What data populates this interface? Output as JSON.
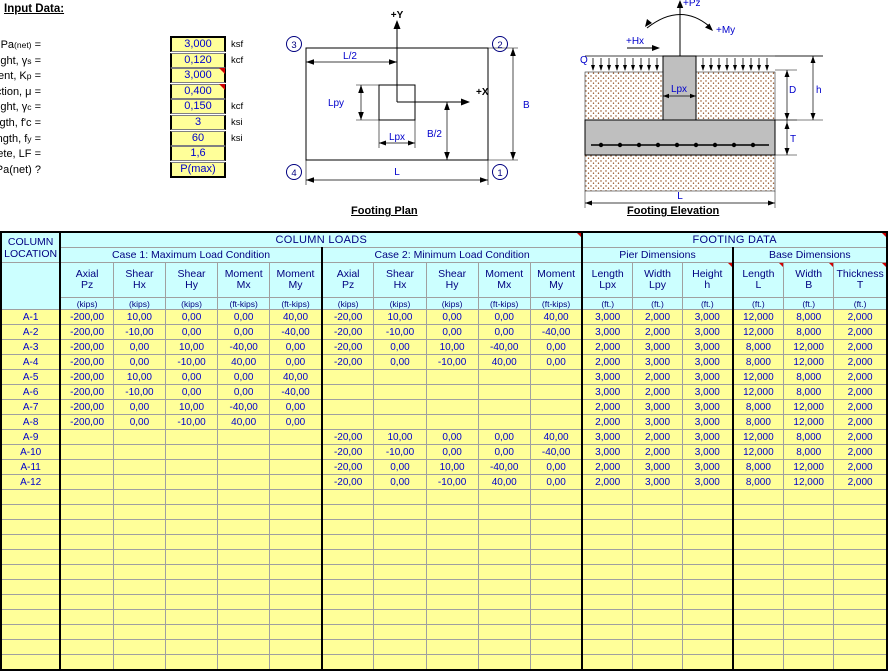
{
  "input_panel": {
    "title": "Input Data:",
    "rows": [
      {
        "label": "Allow. Net Soil Pressure, Pa(net) =",
        "label_main": "Allow. Net Soil Pressure, Pa",
        "label_sub": "(net)",
        "label_tail": " =",
        "value": "3,000",
        "unit": "ksf",
        "comment": false
      },
      {
        "label": "Soil Unit Weight, γs =",
        "label_main": "Soil Unit Weight, γ",
        "label_sub": "s",
        "label_tail": " =",
        "value": "0,120",
        "unit": "kcf",
        "comment": false
      },
      {
        "label": "Passive Pressure Coefficient, Kp =",
        "label_main": "Passive Pressure Coefficient, K",
        "label_sub": "p",
        "label_tail": " =",
        "value": "3,000",
        "unit": "",
        "comment": true
      },
      {
        "label": "Coefficient of Base Friction, μ =",
        "label_main": "Coefficient of Base Friction, μ",
        "label_sub": "",
        "label_tail": " =",
        "value": "0,400",
        "unit": "",
        "comment": true
      },
      {
        "label": "Concrete Unit Weight, γc =",
        "label_main": "Concrete Unit Weight, γ",
        "label_sub": "c",
        "label_tail": " =",
        "value": "0,150",
        "unit": "kcf",
        "comment": false
      },
      {
        "label": "Conc. Compressive Strength, f'c =",
        "label_main": "Conc. Compressive Strength, f'c",
        "label_sub": "",
        "label_tail": " =",
        "value": "3",
        "unit": "ksi",
        "comment": false
      },
      {
        "label": "Reinforcing Yield Strength, fy =",
        "label_main": "Reinforcing Yield Strength, f",
        "label_sub": "y",
        "label_tail": " =",
        "value": "60",
        "unit": "ksi",
        "comment": false
      },
      {
        "label": "USD Load Fact. for Concrete, LF =",
        "label_main": "USD Load Fact. for Concrete, LF",
        "label_sub": "",
        "label_tail": " =",
        "value": "1,6",
        "unit": "",
        "comment": false
      },
      {
        "label": "Design for P(max)net or Pa(net) ?",
        "label_main": "Design for P",
        "label_sub": "(max)net",
        "label_tail": " or Pa(net) ?",
        "value": "P(max)",
        "unit": "",
        "comment": false
      }
    ]
  },
  "plan_diagram": {
    "caption": "Footing Plan",
    "labels": {
      "axis_y": "+Y",
      "axis_x": "+X",
      "corner_1": "1",
      "corner_2": "2",
      "corner_3": "3",
      "corner_4": "4",
      "dim_L": "L",
      "dim_L_half": "L/2",
      "dim_B": "B",
      "dim_B_half": "B/2",
      "dim_Lpx": "Lpx",
      "dim_Lpy": "Lpy"
    }
  },
  "elevation_diagram": {
    "caption": "Footing Elevation",
    "labels": {
      "axial": "+Pz",
      "moment": "+My",
      "shear": "+Hx",
      "surcharge": "Q",
      "pier_width": "Lpx",
      "depth_D": "D",
      "height_h": "h",
      "thickness_T": "T",
      "length_L": "L"
    }
  },
  "table": {
    "group_headers": [
      {
        "label": "COLUMN LOADS",
        "span": 10
      },
      {
        "label": "FOOTING DATA",
        "span": 6
      }
    ],
    "case_headers": [
      {
        "label": "Case 1: Maximum Load Condition",
        "span": 5
      },
      {
        "label": "Case 2: Minimum Load Condition",
        "span": 5
      },
      {
        "label": "Pier Dimensions",
        "span": 3
      },
      {
        "label": "Base Dimensions",
        "span": 3
      }
    ],
    "row_header": "COLUMN LOCATION",
    "row_header_line1": "COLUMN",
    "row_header_line2": "LOCATION",
    "columns": [
      {
        "name_line1": "Axial",
        "name_line2": "Pz",
        "unit": "(kips)",
        "comment": false
      },
      {
        "name_line1": "Shear",
        "name_line2": "Hx",
        "unit": "(kips)",
        "comment": false
      },
      {
        "name_line1": "Shear",
        "name_line2": "Hy",
        "unit": "(kips)",
        "comment": false
      },
      {
        "name_line1": "Moment",
        "name_line2": "Mx",
        "unit": "(ft-kips)",
        "comment": false
      },
      {
        "name_line1": "Moment",
        "name_line2": "My",
        "unit": "(ft-kips)",
        "comment": false
      },
      {
        "name_line1": "Axial",
        "name_line2": "Pz",
        "unit": "(kips)",
        "comment": false
      },
      {
        "name_line1": "Shear",
        "name_line2": "Hx",
        "unit": "(kips)",
        "comment": false
      },
      {
        "name_line1": "Shear",
        "name_line2": "Hy",
        "unit": "(kips)",
        "comment": false
      },
      {
        "name_line1": "Moment",
        "name_line2": "Mx",
        "unit": "(ft-kips)",
        "comment": false
      },
      {
        "name_line1": "Moment",
        "name_line2": "My",
        "unit": "(ft-kips)",
        "comment": false
      },
      {
        "name_line1": "Length",
        "name_line2": "Lpx",
        "unit": "(ft.)",
        "comment": false
      },
      {
        "name_line1": "Width",
        "name_line2": "Lpy",
        "unit": "(ft.)",
        "comment": false
      },
      {
        "name_line1": "Height",
        "name_line2": "h",
        "unit": "(ft.)",
        "comment": true
      },
      {
        "name_line1": "Length",
        "name_line2": "L",
        "unit": "(ft.)",
        "comment": true
      },
      {
        "name_line1": "Width",
        "name_line2": "B",
        "unit": "(ft.)",
        "comment": true
      },
      {
        "name_line1": "Thickness",
        "name_line2": "T",
        "unit": "(ft.)",
        "comment": true
      }
    ],
    "rows": [
      {
        "loc": "A-1",
        "vals": [
          "-200,00",
          "10,00",
          "0,00",
          "0,00",
          "40,00",
          "-20,00",
          "10,00",
          "0,00",
          "0,00",
          "40,00",
          "3,000",
          "2,000",
          "3,000",
          "12,000",
          "8,000",
          "2,000"
        ]
      },
      {
        "loc": "A-2",
        "vals": [
          "-200,00",
          "-10,00",
          "0,00",
          "0,00",
          "-40,00",
          "-20,00",
          "-10,00",
          "0,00",
          "0,00",
          "-40,00",
          "3,000",
          "2,000",
          "3,000",
          "12,000",
          "8,000",
          "2,000"
        ]
      },
      {
        "loc": "A-3",
        "vals": [
          "-200,00",
          "0,00",
          "10,00",
          "-40,00",
          "0,00",
          "-20,00",
          "0,00",
          "10,00",
          "-40,00",
          "0,00",
          "2,000",
          "3,000",
          "3,000",
          "8,000",
          "12,000",
          "2,000"
        ]
      },
      {
        "loc": "A-4",
        "vals": [
          "-200,00",
          "0,00",
          "-10,00",
          "40,00",
          "0,00",
          "-20,00",
          "0,00",
          "-10,00",
          "40,00",
          "0,00",
          "2,000",
          "3,000",
          "3,000",
          "8,000",
          "12,000",
          "2,000"
        ]
      },
      {
        "loc": "A-5",
        "vals": [
          "-200,00",
          "10,00",
          "0,00",
          "0,00",
          "40,00",
          "",
          "",
          "",
          "",
          "",
          "3,000",
          "2,000",
          "3,000",
          "12,000",
          "8,000",
          "2,000"
        ]
      },
      {
        "loc": "A-6",
        "vals": [
          "-200,00",
          "-10,00",
          "0,00",
          "0,00",
          "-40,00",
          "",
          "",
          "",
          "",
          "",
          "3,000",
          "2,000",
          "3,000",
          "12,000",
          "8,000",
          "2,000"
        ]
      },
      {
        "loc": "A-7",
        "vals": [
          "-200,00",
          "0,00",
          "10,00",
          "-40,00",
          "0,00",
          "",
          "",
          "",
          "",
          "",
          "2,000",
          "3,000",
          "3,000",
          "8,000",
          "12,000",
          "2,000"
        ]
      },
      {
        "loc": "A-8",
        "vals": [
          "-200,00",
          "0,00",
          "-10,00",
          "40,00",
          "0,00",
          "",
          "",
          "",
          "",
          "",
          "2,000",
          "3,000",
          "3,000",
          "8,000",
          "12,000",
          "2,000"
        ]
      },
      {
        "loc": "A-9",
        "vals": [
          "",
          "",
          "",
          "",
          "",
          "-20,00",
          "10,00",
          "0,00",
          "0,00",
          "40,00",
          "3,000",
          "2,000",
          "3,000",
          "12,000",
          "8,000",
          "2,000"
        ]
      },
      {
        "loc": "A-10",
        "vals": [
          "",
          "",
          "",
          "",
          "",
          "-20,00",
          "-10,00",
          "0,00",
          "0,00",
          "-40,00",
          "3,000",
          "2,000",
          "3,000",
          "12,000",
          "8,000",
          "2,000"
        ]
      },
      {
        "loc": "A-11",
        "vals": [
          "",
          "",
          "",
          "",
          "",
          "-20,00",
          "0,00",
          "10,00",
          "-40,00",
          "0,00",
          "2,000",
          "3,000",
          "3,000",
          "8,000",
          "12,000",
          "2,000"
        ]
      },
      {
        "loc": "A-12",
        "vals": [
          "",
          "",
          "",
          "",
          "",
          "-20,00",
          "0,00",
          "-10,00",
          "40,00",
          "0,00",
          "2,000",
          "3,000",
          "3,000",
          "8,000",
          "12,000",
          "2,000"
        ]
      },
      {
        "loc": "",
        "vals": [
          "",
          "",
          "",
          "",
          "",
          "",
          "",
          "",
          "",
          "",
          "",
          "",
          "",
          "",
          "",
          ""
        ]
      },
      {
        "loc": "",
        "vals": [
          "",
          "",
          "",
          "",
          "",
          "",
          "",
          "",
          "",
          "",
          "",
          "",
          "",
          "",
          "",
          ""
        ]
      },
      {
        "loc": "",
        "vals": [
          "",
          "",
          "",
          "",
          "",
          "",
          "",
          "",
          "",
          "",
          "",
          "",
          "",
          "",
          "",
          ""
        ]
      },
      {
        "loc": "",
        "vals": [
          "",
          "",
          "",
          "",
          "",
          "",
          "",
          "",
          "",
          "",
          "",
          "",
          "",
          "",
          "",
          ""
        ]
      },
      {
        "loc": "",
        "vals": [
          "",
          "",
          "",
          "",
          "",
          "",
          "",
          "",
          "",
          "",
          "",
          "",
          "",
          "",
          "",
          ""
        ]
      },
      {
        "loc": "",
        "vals": [
          "",
          "",
          "",
          "",
          "",
          "",
          "",
          "",
          "",
          "",
          "",
          "",
          "",
          "",
          "",
          ""
        ]
      },
      {
        "loc": "",
        "vals": [
          "",
          "",
          "",
          "",
          "",
          "",
          "",
          "",
          "",
          "",
          "",
          "",
          "",
          "",
          "",
          ""
        ]
      },
      {
        "loc": "",
        "vals": [
          "",
          "",
          "",
          "",
          "",
          "",
          "",
          "",
          "",
          "",
          "",
          "",
          "",
          "",
          "",
          ""
        ]
      },
      {
        "loc": "",
        "vals": [
          "",
          "",
          "",
          "",
          "",
          "",
          "",
          "",
          "",
          "",
          "",
          "",
          "",
          "",
          "",
          ""
        ]
      },
      {
        "loc": "",
        "vals": [
          "",
          "",
          "",
          "",
          "",
          "",
          "",
          "",
          "",
          "",
          "",
          "",
          "",
          "",
          "",
          ""
        ]
      },
      {
        "loc": "",
        "vals": [
          "",
          "",
          "",
          "",
          "",
          "",
          "",
          "",
          "",
          "",
          "",
          "",
          "",
          "",
          "",
          ""
        ]
      },
      {
        "loc": "",
        "vals": [
          "",
          "",
          "",
          "",
          "",
          "",
          "",
          "",
          "",
          "",
          "",
          "",
          "",
          "",
          "",
          ""
        ]
      }
    ]
  },
  "colors": {
    "input_cell_bg": "#ffff99",
    "header_bg": "#ccffff",
    "value_text": "#0000cc",
    "header_text": "#000080",
    "comment_marker": "#d00000",
    "concrete_fill": "#bfbfbf",
    "soil_hatch": "#8b4513"
  }
}
